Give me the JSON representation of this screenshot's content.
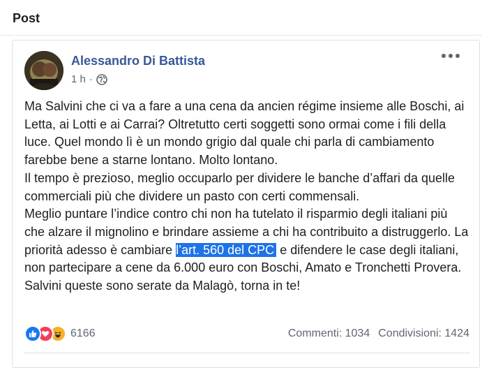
{
  "panel": {
    "title": "Post"
  },
  "post": {
    "author": "Alessandro Di Battista",
    "time": "1 h",
    "audience_icon": "globe-icon",
    "more_icon": "more-options-icon",
    "paragraphs": [
      "Ma Salvini che ci va a fare a una cena da ancien régime insieme alle Boschi, ai Letta, ai Lotti e ai Carrai? Oltretutto certi soggetti sono ormai come i fili della luce. Quel mondo lì è un mondo grigio dal quale chi parla di cambiamento farebbe bene a starne lontano. Molto lontano.",
      "Il tempo è prezioso, meglio occuparlo per dividere le banche d’affari da quelle commerciali più che dividere un pasto con certi commensali."
    ],
    "para3_before": "Meglio puntare l’indice contro chi non ha tutelato il risparmio degli italiani più che alzare il mignolino e brindare assieme a chi ha contribuito a distruggerlo. La priorità adesso è cambiare ",
    "para3_highlight": "l’art. 560 del CPC",
    "para3_after": " e difendere le case degli italiani, non partecipare a cene da 6.000 euro con Boschi, Amato e Tronchetti Provera.",
    "para4": "Salvini queste sono serate da Malagò, torna in te!"
  },
  "footer": {
    "reaction_icons": [
      "like-icon",
      "love-icon",
      "haha-icon"
    ],
    "reaction_count": "6166",
    "comments": "Commenti: 1034",
    "shares": "Condivisioni: 1424"
  },
  "colors": {
    "author": "#385898",
    "highlight": "#1e73e6",
    "like": "#1877f2",
    "love": "#f33e58",
    "haha": "#f7b125"
  }
}
